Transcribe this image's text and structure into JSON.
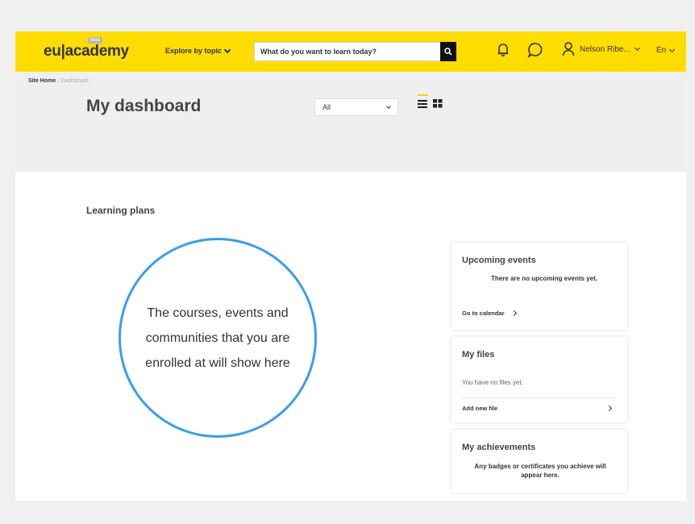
{
  "header": {
    "logo": "eu|academy",
    "beta": "beta",
    "explore_label": "Explore by topic",
    "search_placeholder": "What do you want to learn today?",
    "user_name": "Nelson Ribe...",
    "language": "En",
    "accent_color": "#ffdd00"
  },
  "breadcrumb": {
    "home": "Site Home",
    "separator": "›",
    "current": "Dashboard"
  },
  "page": {
    "title": "My dashboard",
    "filter_value": "All",
    "view_modes": [
      "list-view-icon",
      "grid-view-icon"
    ],
    "active_view": "list"
  },
  "main": {
    "section_title": "Learning plans",
    "empty_message": "The courses, events and communities that you are enrolled at will show here",
    "circle_color": "#3a9ee8"
  },
  "sidebar": {
    "events": {
      "title": "Upcoming events",
      "message": "There are no upcoming events yet.",
      "link": "Go to calendar"
    },
    "files": {
      "title": "My files",
      "message": "You have no files yet.",
      "link": "Add new file"
    },
    "achievements": {
      "title": "My achievements",
      "message": "Any badges or certificates you achieve will appear here."
    }
  }
}
